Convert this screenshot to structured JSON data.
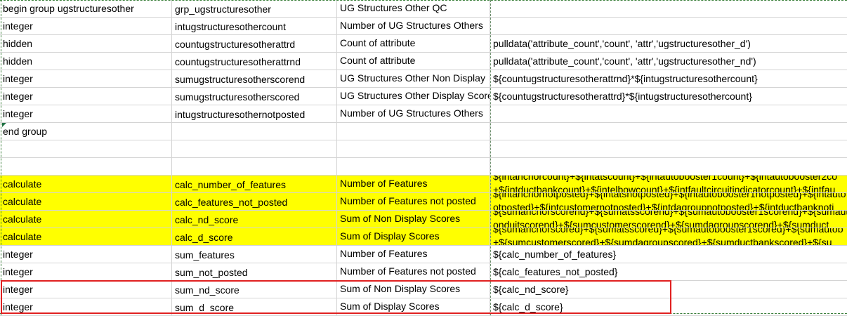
{
  "rows": [
    {
      "type": "begin group ugstructuresother",
      "name": "grp_ugstructuresother",
      "label": "UG Structures Other QC",
      "calc": "",
      "highlight": false
    },
    {
      "type": "integer",
      "name": "intugstructuresothercount",
      "label": "Number of UG Structures Others",
      "calc": "",
      "highlight": false
    },
    {
      "type": "hidden",
      "name": "countugstructuresotherattrd",
      "label": "Count of attribute",
      "calc": "pulldata('attribute_count','count', 'attr','ugstructuresother_d')",
      "highlight": false
    },
    {
      "type": "hidden",
      "name": "countugstructuresotherattrnd",
      "label": "Count of attribute",
      "calc": "pulldata('attribute_count','count', 'attr','ugstructuresother_nd')",
      "highlight": false
    },
    {
      "type": "integer",
      "name": "sumugstructuresotherscorend",
      "label": "UG Structures Other Non Display",
      "calc": "${countugstructuresotherattrnd}*${intugstructuresothercount}",
      "highlight": false
    },
    {
      "type": "integer",
      "name": "sumugstructuresotherscored",
      "label": "UG Structures Other Display Score",
      "calc": "${countugstructuresotherattrd}*${intugstructuresothercount}",
      "highlight": false
    },
    {
      "type": "integer",
      "name": "intugstructuresothernotposted",
      "label": "Number of UG Structures Others",
      "calc": "",
      "highlight": false
    },
    {
      "type": "end group",
      "name": "",
      "label": "",
      "calc": "",
      "highlight": false
    },
    {
      "type": "",
      "name": "",
      "label": "",
      "calc": "",
      "highlight": false
    },
    {
      "type": "",
      "name": "",
      "label": "",
      "calc": "",
      "highlight": false
    },
    {
      "type": "calculate",
      "name": "calc_number_of_features",
      "label": "Number of Features",
      "calc_line1": "${intanchorcount}+${intatscount}+${intautobooster1count}+${intautobooster2co",
      "calc_line2": "+${intductbankcount}+${intelbowcount}+${intfaultcircuitindicatorcount}+${intfau",
      "highlight": true
    },
    {
      "type": "calculate",
      "name": "calc_features_not_posted",
      "label": "Number of Features not posted",
      "calc_line1": "${intanchornotposted}+${intatsnotposted}+${intautobooster1notposted}+${intauto",
      "calc_line2": "otposted}+${intcustomernotposted}+${intdagroupnotposted}+${intductbanknoti",
      "highlight": true
    },
    {
      "type": "calculate",
      "name": "calc_nd_score",
      "label": "Sum of Non Display Scores",
      "calc_line1": "${sumanchorscorend}+${sumatsscorend}+${sumautobooster1scorend}+${sumaut",
      "calc_line2": "onduitscorend}+${sumcustomerscorend}+${sumdagroupscorend}+${sumduct",
      "highlight": true
    },
    {
      "type": "calculate",
      "name": "calc_d_score",
      "label": "Sum of Display Scores",
      "calc_line1": "${sumanchorscored}+${sumatsscored}+${sumautobooster1scored}+${sumautob",
      "calc_line2": "+${sumcustomerscored}+${sumdagroupscored}+${sumductbankscored}+${su",
      "highlight": true
    },
    {
      "type": "integer",
      "name": "sum_features",
      "label": "Number of Features",
      "calc": "${calc_number_of_features}",
      "highlight": false
    },
    {
      "type": "integer",
      "name": "sum_not_posted",
      "label": "Number of Features not posted",
      "calc": "${calc_features_not_posted}",
      "highlight": false
    },
    {
      "type": "integer",
      "name": "sum_nd_score",
      "label": "Sum of Non Display Scores",
      "calc": "${calc_nd_score}",
      "highlight": false
    },
    {
      "type": "integer",
      "name": "sum_d_score",
      "label": "Sum of Display Scores",
      "calc": "${calc_d_score}",
      "highlight": false
    }
  ],
  "colors": {
    "highlight_fill": "#ffff00",
    "annotation_box": "#e02020",
    "marquee": "#3a7f3a",
    "gridline": "#d4d4d4"
  }
}
